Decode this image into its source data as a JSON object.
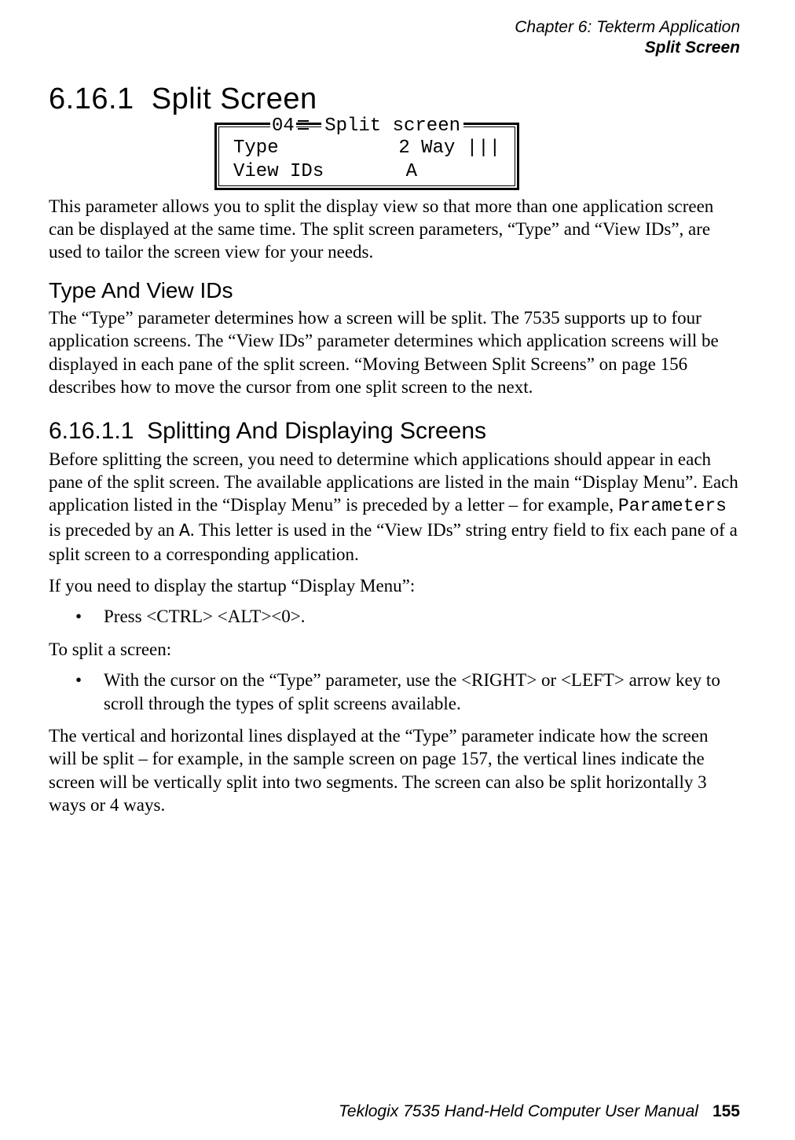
{
  "header": {
    "chapter": "Chapter 6: Tekterm Application",
    "subtitle": "Split Screen"
  },
  "section_6_16_1": {
    "number": "6.16.1",
    "title": "Split Screen"
  },
  "screen_box": {
    "title_num": "04",
    "title_text": "Split screen",
    "rows": [
      {
        "label": "Type",
        "value": "2 Way |||"
      },
      {
        "label": "View IDs",
        "value": "A"
      }
    ]
  },
  "para1": "This parameter allows you to split the display view so that more than one application screen can be displayed at the same time. The split screen parameters, “Type” and “View IDs”, are used to tailor the screen view for your needs.",
  "subheading_type_view": "Type And View IDs",
  "para2": "The “Type” parameter determines how a screen will be split. The 7535 supports up to four application screens. The “View IDs” parameter determines which application screens will be displayed in each pane of the split screen. “Moving Between Split Screens” on page 156 describes how to move the cursor from one split screen to the next.",
  "section_6_16_1_1": {
    "number": "6.16.1.1",
    "title": "Splitting And Displaying Screens"
  },
  "para3_a": "Before splitting the screen, you need to determine which applications should appear in each pane of the split screen. The available applications are listed in the main “Display Menu”. Each application listed in the “Display Menu” is preceded by a letter – for example, ",
  "para3_mono1": "Parameters",
  "para3_b": " is preceded by an ",
  "para3_mono2": "A",
  "para3_c": ". This letter is used in the “View IDs” string entry field to fix each pane of a split screen to a corresponding application.",
  "para4": "If you need to display the startup “Display Menu”:",
  "bullet1": "Press <CTRL> <ALT><0>.",
  "para5": "To split a screen:",
  "bullet2": "With the cursor on the “Type” parameter, use the <RIGHT> or <LEFT> arrow key to scroll through the types of split screens available.",
  "para6": "The vertical and horizontal lines displayed at the “Type” parameter indicate how the screen will be split – for example, in the sample screen on page 157, the vertical lines indicate the screen will be vertically split into two segments. The screen can also be split horizontally 3 ways or 4 ways.",
  "footer": {
    "text": "Teklogix 7535 Hand-Held Computer User Manual",
    "page": "155"
  }
}
